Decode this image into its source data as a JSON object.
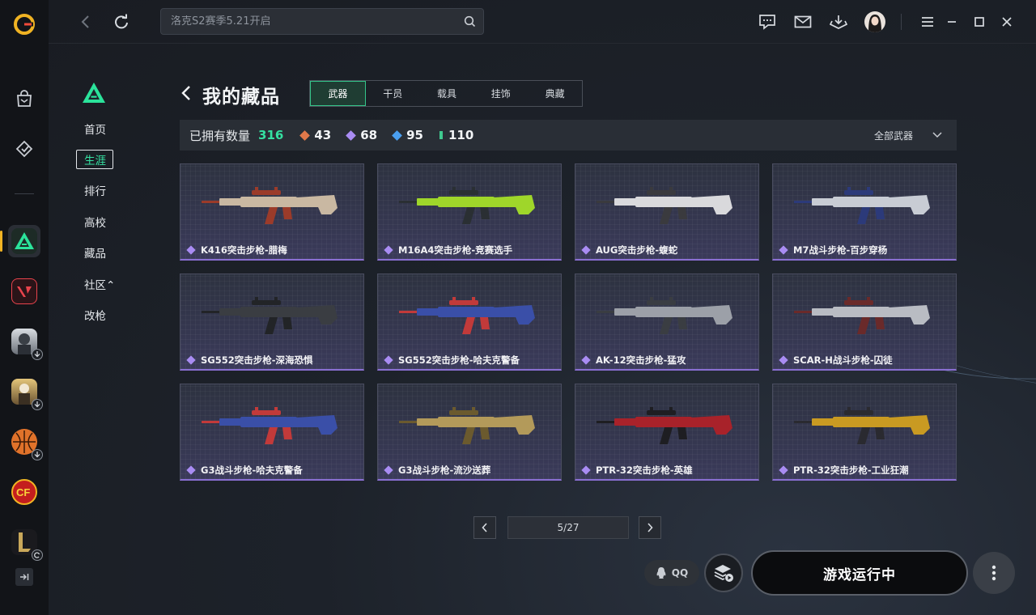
{
  "search": {
    "placeholder": "洛克S2赛季5.21开启"
  },
  "rail": {
    "games": [
      {
        "name": "game-delta-force",
        "active": true
      },
      {
        "name": "game-valorant"
      },
      {
        "name": "game-pubg-mobile"
      },
      {
        "name": "game-pubg"
      },
      {
        "name": "game-basketball"
      },
      {
        "name": "game-crossfire"
      },
      {
        "name": "game-league-of-legends"
      }
    ]
  },
  "subnav": {
    "items": [
      {
        "label": "首页"
      },
      {
        "label": "生涯",
        "active": true
      },
      {
        "label": "排行"
      },
      {
        "label": "高校"
      },
      {
        "label": "藏品"
      },
      {
        "label": "社区⌃"
      },
      {
        "label": "改枪"
      }
    ]
  },
  "page": {
    "title": "我的藏品"
  },
  "tabs": [
    {
      "label": "武器",
      "active": true
    },
    {
      "label": "干员"
    },
    {
      "label": "载具"
    },
    {
      "label": "挂饰"
    },
    {
      "label": "典藏"
    }
  ],
  "stats": {
    "label": "已拥有数量",
    "total": "316",
    "tiers": [
      {
        "value": "43",
        "color": "#e0784a"
      },
      {
        "value": "68",
        "color": "#a98cf3"
      },
      {
        "value": "95",
        "color": "#4a9ff0"
      },
      {
        "value": "110",
        "color": "#3fc98f"
      }
    ],
    "filter": "全部武器"
  },
  "items": [
    {
      "label": "K416突击步枪-腊梅",
      "body": "#c9b8a2",
      "accent": "#9b3b2a"
    },
    {
      "label": "M16A4突击步枪-竞赛选手",
      "body": "#9fd62a",
      "accent": "#2a2f33"
    },
    {
      "label": "AUG突击步枪-蝮蛇",
      "body": "#d9d9dc",
      "accent": "#3a3a3e"
    },
    {
      "label": "M7战斗步枪-百步穿杨",
      "body": "#c8ccd4",
      "accent": "#2c3a7a"
    },
    {
      "label": "SG552突击步枪-深海恐惧",
      "body": "#3a3d42",
      "accent": "#222427"
    },
    {
      "label": "SG552突击步枪-哈夫克警备",
      "body": "#3a4fa8",
      "accent": "#c23a3a"
    },
    {
      "label": "AK-12突击步枪-猛攻",
      "body": "#9ca0a8",
      "accent": "#3a3d42"
    },
    {
      "label": "SCAR-H战斗步枪-囚徒",
      "body": "#b9bcc3",
      "accent": "#6a2a2a"
    },
    {
      "label": "G3战斗步枪-哈夫克警备",
      "body": "#3a4fa8",
      "accent": "#c23a3a"
    },
    {
      "label": "G3战斗步枪-流沙送葬",
      "body": "#b39a5a",
      "accent": "#6b5a2e"
    },
    {
      "label": "PTR-32突击步枪-英雄",
      "body": "#a8222a",
      "accent": "#1e1e22"
    },
    {
      "label": "PTR-32突击步枪-工业狂潮",
      "body": "#c99a22",
      "accent": "#2a2a30"
    }
  ],
  "pagination": {
    "indicator": "5/27"
  },
  "bottom": {
    "qq": "QQ",
    "launch": "游戏运行中"
  }
}
